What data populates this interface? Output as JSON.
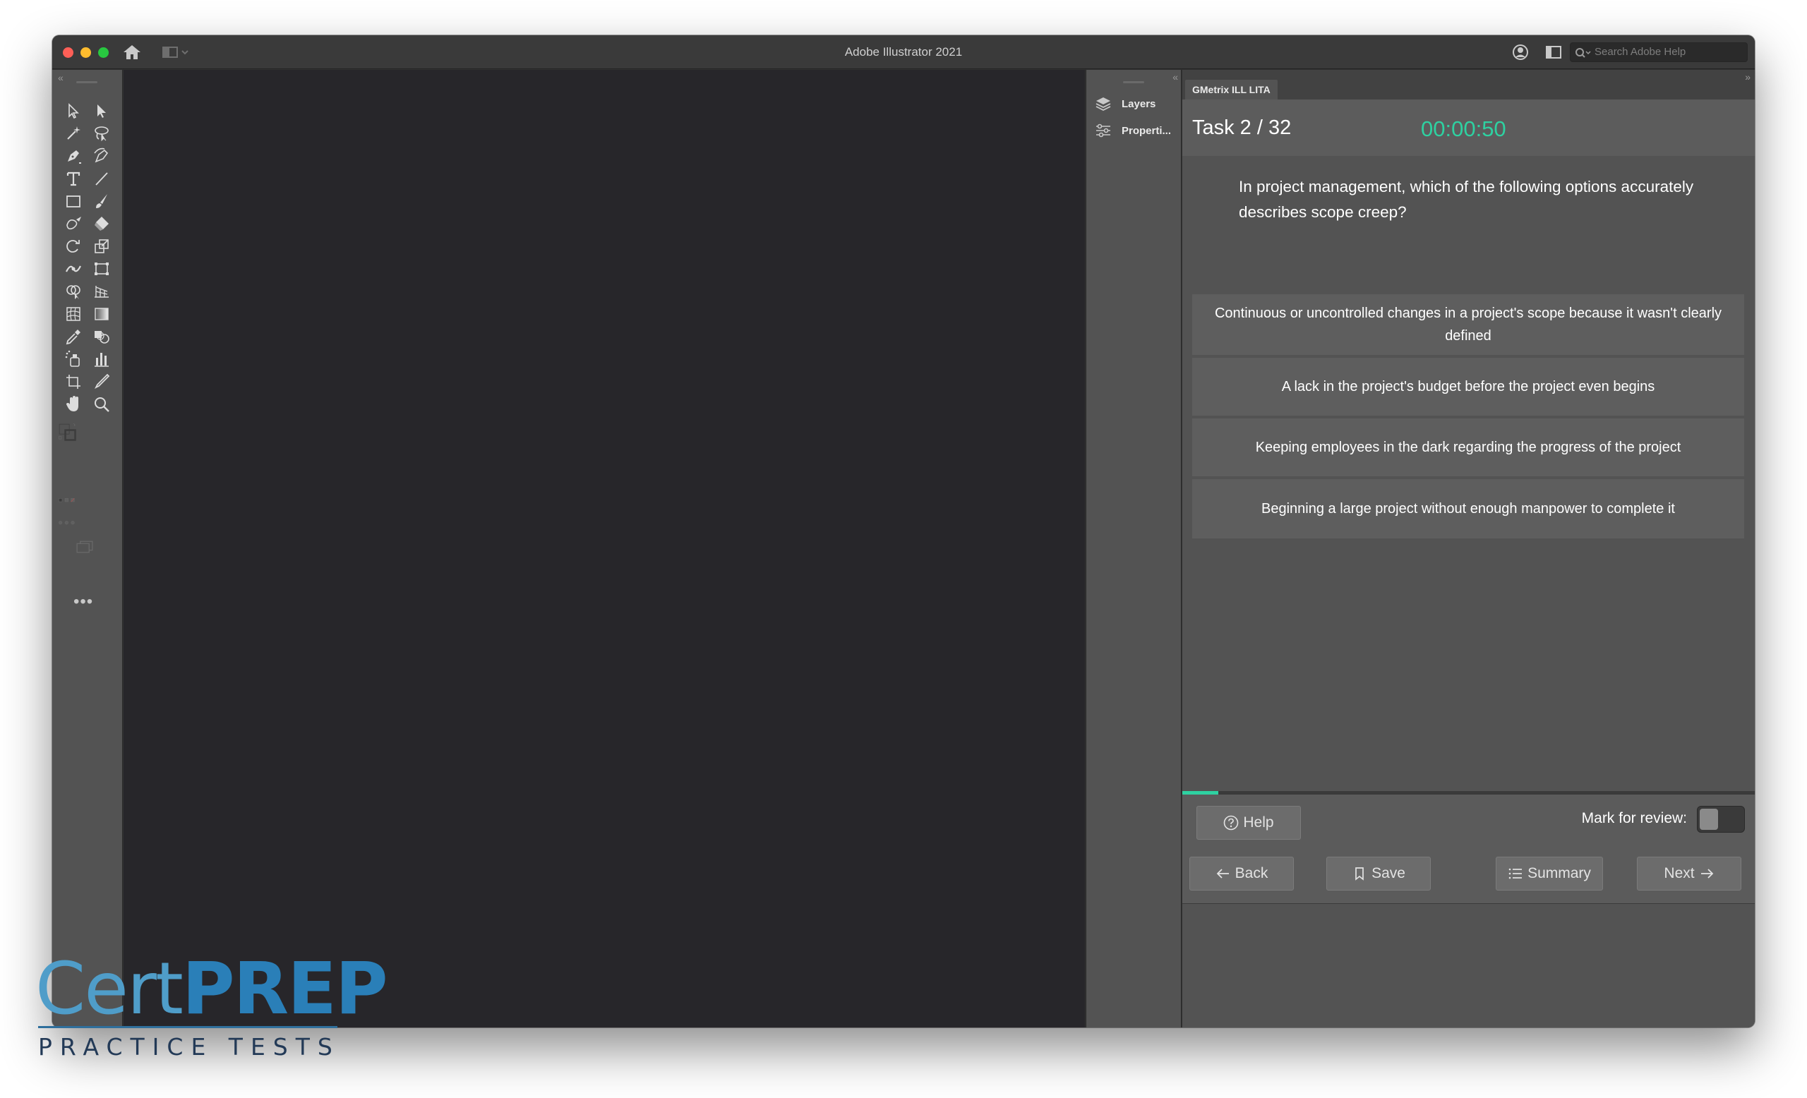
{
  "window": {
    "title": "Adobe Illustrator 2021",
    "search_placeholder": "Search Adobe Help"
  },
  "panels": {
    "layers_label": "Layers",
    "properties_label": "Properti..."
  },
  "gmetrix": {
    "tab_label": "GMetrix ILL LITA",
    "task_label": "Task 2 / 32",
    "timer": "00:00:50",
    "question": "In project management, which of the following options accurately describes scope creep?",
    "answers": [
      "Continuous or uncontrolled changes in a project's scope because it wasn't clearly defined",
      "A lack in the project's budget before the project even begins",
      "Keeping employees in the dark regarding the progress of the project",
      "Beginning a large project without enough manpower to complete it"
    ],
    "progress_fraction": 0.0625,
    "help_label": "Help",
    "mark_for_review_label": "Mark for review:",
    "mark_for_review_on": false,
    "back_label": "Back",
    "save_label": "Save",
    "summary_label": "Summary",
    "next_label": "Next",
    "accent_color": "#2ed1a1"
  },
  "watermark": {
    "brand_part1": "Cert",
    "brand_part2": "PREP",
    "tagline": "PRACTICE TESTS"
  }
}
